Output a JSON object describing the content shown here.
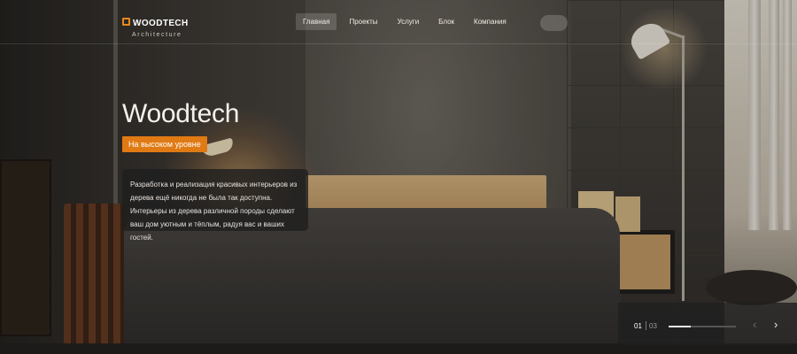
{
  "brand": {
    "name": "WOODTECH",
    "subtitle": "Architecture",
    "accent_color": "#e07a14"
  },
  "nav": {
    "items": [
      {
        "label": "Главная",
        "active": true
      },
      {
        "label": "Проекты",
        "active": false
      },
      {
        "label": "Услуги",
        "active": false
      },
      {
        "label": "Блок",
        "active": false
      },
      {
        "label": "Компания",
        "active": false
      }
    ]
  },
  "hero": {
    "title": "Woodtech",
    "badge": "На высоком уровне",
    "description": "Разработка и реализация красивых интерьеров из дерева ещё никогда не была так доступна. Интерьеры из дерева различной породы сделают ваш дом уютным и тёплым, радуя вас и ваших гостей."
  },
  "slider": {
    "current": "01",
    "total": "03",
    "progress": 0.33,
    "prev_icon": "chevron-left-icon",
    "next_icon": "chevron-right-icon"
  }
}
